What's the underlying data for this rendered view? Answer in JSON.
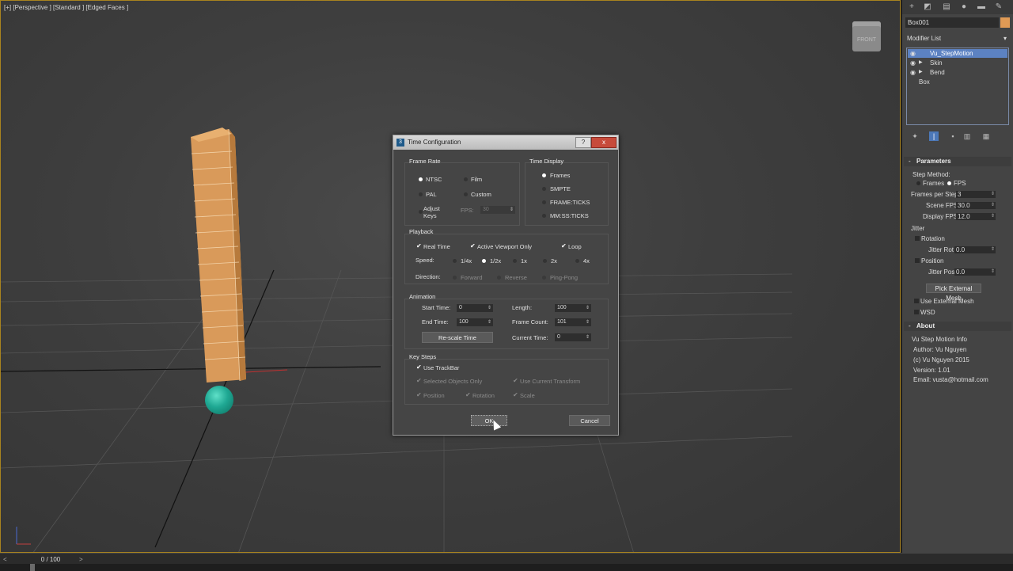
{
  "viewport": {
    "label": "[+] [Perspective ] [Standard ] [Edged Faces ]",
    "navcube_label": "FRONT"
  },
  "timeline": {
    "frame": "0 / 100",
    "prev": "<",
    "next": ">"
  },
  "panel": {
    "object_name": "Box001",
    "object_color": "#e09a55",
    "modifier_list": "Modifier List",
    "stack": [
      {
        "name": "Vu_StepMotion",
        "selected": true
      },
      {
        "name": "Skin"
      },
      {
        "name": "Bend"
      },
      {
        "name": "Box"
      }
    ],
    "parameters": {
      "title": "Parameters",
      "step_method": "Step Method:",
      "frames": "Frames",
      "fps": "FPS",
      "frames_per_step_label": "Frames per Step",
      "frames_per_step": "3",
      "scene_fps_label": "Scene FPS",
      "scene_fps": "30.0",
      "display_fps_label": "Display FPS",
      "display_fps": "12.0",
      "jitter": "Jitter",
      "rotation": "Rotation",
      "jitter_rot_label": "Jitter Rot",
      "jitter_rot": "0.0",
      "position": "Position",
      "jitter_pos_label": "Jitter Pos",
      "jitter_pos": "0.0",
      "pick_external": "Pick External Mesh",
      "use_external": "Use External Mesh",
      "wsd": "WSD"
    },
    "about": {
      "title": "About",
      "lines": [
        "Vu Step Motion Info",
        "Author: Vu Nguyen",
        "(c) Vu Nguyen 2015",
        "Version: 1.01",
        "Email: vusta@hotmail.com"
      ]
    }
  },
  "dialog": {
    "title": "Time Configuration",
    "help": "?",
    "close": "x",
    "frame_rate": {
      "title": "Frame Rate",
      "ntsc": "NTSC",
      "film": "Film",
      "pal": "PAL",
      "custom": "Custom",
      "adjust_keys_1": "Adjust",
      "adjust_keys_2": "Keys",
      "fps_label": "FPS:",
      "fps_value": "30"
    },
    "time_display": {
      "title": "Time Display",
      "frames": "Frames",
      "smpte": "SMPTE",
      "frame_ticks": "FRAME:TICKS",
      "mm_ss_ticks": "MM:SS:TICKS"
    },
    "playback": {
      "title": "Playback",
      "real_time": "Real Time",
      "active_viewport": "Active Viewport Only",
      "loop": "Loop",
      "speed": "Speed:",
      "s1": "1/4x",
      "s2": "1/2x",
      "s3": "1x",
      "s4": "2x",
      "s5": "4x",
      "direction": "Direction:",
      "forward": "Forward",
      "reverse": "Reverse",
      "ping_pong": "Ping-Pong"
    },
    "animation": {
      "title": "Animation",
      "start_label": "Start Time:",
      "start": "0",
      "end_label": "End Time:",
      "end": "100",
      "length_label": "Length:",
      "length": "100",
      "frame_count_label": "Frame Count:",
      "frame_count": "101",
      "rescale": "Re-scale Time",
      "current_label": "Current Time:",
      "current": "0"
    },
    "key_steps": {
      "title": "Key Steps",
      "use_trackbar": "Use TrackBar",
      "selected_only": "Selected Objects Only",
      "use_current": "Use Current Transform",
      "position": "Position",
      "rotation": "Rotation",
      "scale": "Scale"
    },
    "ok": "OK",
    "cancel": "Cancel"
  }
}
